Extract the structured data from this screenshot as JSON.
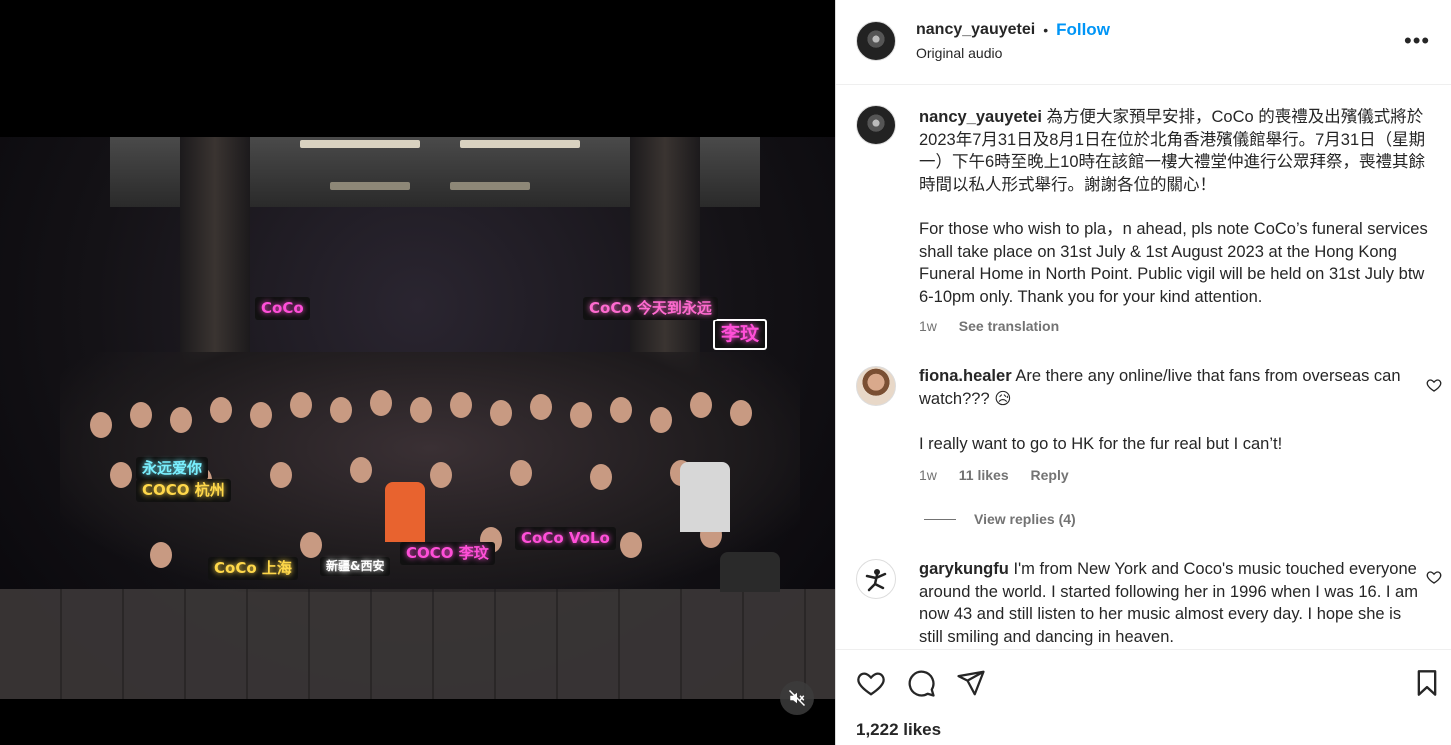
{
  "post": {
    "username": "nancy_yauyetei",
    "separator": "•",
    "follow_label": "Follow",
    "audio_label": "Original audio",
    "caption_chinese": "為方便大家預早安排，CoCo 的喪禮及出殯儀式將於2023年7月31日及8月1日在位於北角香港殯儀館舉行。7月31日（星期一）下午6時至晚上10時在該館一樓大禮堂仲進行公眾拜祭，喪禮其餘時間以私人形式舉行。謝謝各位的關心！",
    "caption_english": "For those who wish to pla，n ahead, pls note CoCo’s funeral services shall take place on 31st July & 1st August 2023 at the Hong Kong Funeral Home in North Point. Public vigil will be held on 31st July btw 6-10pm only. Thank you for your kind attention.",
    "time": "1w",
    "see_translation": "See translation",
    "likes": "1,222 likes",
    "more_icon": "more-options-icon"
  },
  "photo_signs": [
    {
      "text": "CoCo",
      "color": "#ff4fd8"
    },
    {
      "text": "李玟",
      "color": "#ff4fd8"
    },
    {
      "text": "CoCo 今天到永远",
      "color": "#ff6bd0"
    },
    {
      "text": "永远爱你",
      "color": "#7af0ff"
    },
    {
      "text": "COCO 杭州",
      "color": "#ffd84a"
    },
    {
      "text": "CoCo 上海",
      "color": "#ffd84a"
    },
    {
      "text": "COCO 李玟",
      "color": "#ff4fd8"
    },
    {
      "text": "CoCo VoLo",
      "color": "#ff4fd8"
    },
    {
      "text": "新疆&西安",
      "color": "#ffffff"
    }
  ],
  "comments": [
    {
      "username": "fiona.healer",
      "text_1": "Are there any online/live that fans from overseas can watch??? 😥",
      "text_2": "I really want to go to HK for the fur real but I can’t!",
      "time": "1w",
      "likes": "11 likes",
      "reply": "Reply",
      "view_replies": "View replies (4)"
    },
    {
      "username": "garykungfu",
      "text": "I'm from New York and Coco's music touched everyone around the world. I started following her in 1996 when I was 16. I am now 43 and still listen to her music almost every day. I hope she is still smiling and dancing in heaven."
    }
  ],
  "colors": {
    "accent": "#0095f6",
    "text": "#262626",
    "muted": "#737373"
  }
}
